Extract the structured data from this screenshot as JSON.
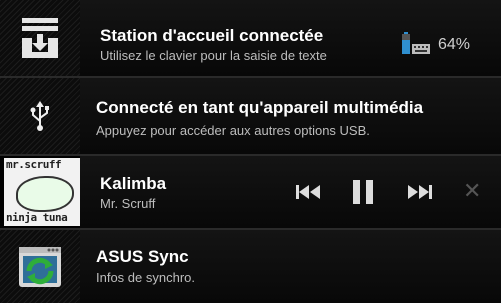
{
  "notifications": [
    {
      "title": "Station d'accueil connectée",
      "subtitle": "Utilisez le clavier pour la saisie de texte",
      "icon": "download-tray-icon",
      "battery": {
        "icon": "keyboard-battery-icon",
        "percent_text": "64%",
        "level": 0.64
      }
    },
    {
      "title": "Connecté en tant qu'appareil multimédia",
      "subtitle": "Appuyez pour accéder aux autres options USB.",
      "icon": "usb-icon"
    },
    {
      "title": "Kalimba",
      "subtitle": "Mr. Scruff",
      "album_art": {
        "line1": "mr.scruff",
        "line2": "ninja tuna"
      },
      "controls": {
        "prev": "previous-icon",
        "pause": "pause-icon",
        "next": "next-icon",
        "close": "close-icon"
      }
    },
    {
      "title": "ASUS Sync",
      "subtitle": "Infos de synchro.",
      "icon": "asus-sync-icon"
    }
  ],
  "colors": {
    "accent_green": "#2eae3a",
    "icon_blue": "#2f6f99"
  }
}
